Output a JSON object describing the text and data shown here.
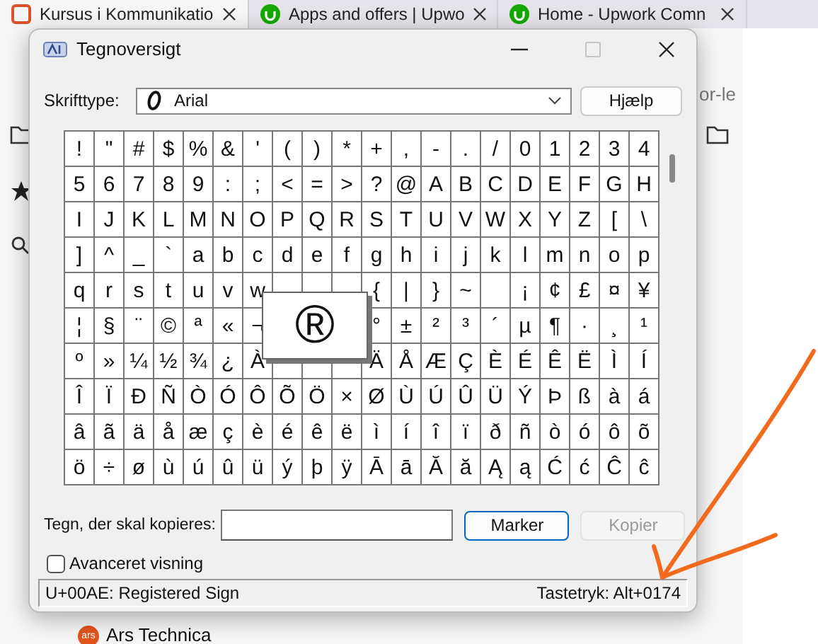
{
  "browser": {
    "tabs": [
      {
        "title": "Kursus i Kommunikatio",
        "selected": true
      },
      {
        "title": "Apps and offers | Upwo",
        "selected": false
      },
      {
        "title": "Home - Upwork Comn",
        "selected": false
      }
    ],
    "address_fragment": "or-le",
    "bookmark_badge": "ars",
    "bookmark": "Ars Technica"
  },
  "window": {
    "title": "Tegnoversigt"
  },
  "font": {
    "label": "Skrifttype:",
    "value": "Arial"
  },
  "help_button": "Hjælp",
  "grid": {
    "rows": [
      [
        "!",
        "\"",
        "#",
        "$",
        "%",
        "&",
        "'",
        "(",
        ")",
        "*",
        "+",
        ",",
        "-",
        ".",
        "/",
        "0",
        "1",
        "2",
        "3",
        "4"
      ],
      [
        "5",
        "6",
        "7",
        "8",
        "9",
        ":",
        ";",
        "<",
        "=",
        ">",
        "?",
        "@",
        "A",
        "B",
        "C",
        "D",
        "E",
        "F",
        "G",
        "H"
      ],
      [
        "I",
        "J",
        "K",
        "L",
        "M",
        "N",
        "O",
        "P",
        "Q",
        "R",
        "S",
        "T",
        "U",
        "V",
        "W",
        "X",
        "Y",
        "Z",
        "[",
        "\\"
      ],
      [
        "]",
        "^",
        "_",
        "`",
        "a",
        "b",
        "c",
        "d",
        "e",
        "f",
        "g",
        "h",
        "i",
        "j",
        "k",
        "l",
        "m",
        "n",
        "o",
        "p"
      ],
      [
        "q",
        "r",
        "s",
        "t",
        "u",
        "v",
        "w",
        null,
        null,
        null,
        "{",
        "|",
        "}",
        "~",
        null,
        "¡",
        "¢",
        "£",
        "¤",
        "¥"
      ],
      [
        "¦",
        "§",
        "¨",
        "©",
        "ª",
        "«",
        "¬",
        null,
        null,
        null,
        "°",
        "±",
        "²",
        "³",
        "´",
        "µ",
        "¶",
        "·",
        "¸",
        "¹"
      ],
      [
        "º",
        "»",
        "¼",
        "½",
        "¾",
        "¿",
        "À",
        null,
        null,
        null,
        "Ä",
        "Å",
        "Æ",
        "Ç",
        "È",
        "É",
        "Ê",
        "Ë",
        "Ì",
        "Í"
      ],
      [
        "Î",
        "Ï",
        "Ð",
        "Ñ",
        "Ò",
        "Ó",
        "Ô",
        "Õ",
        "Ö",
        "×",
        "Ø",
        "Ù",
        "Ú",
        "Û",
        "Ü",
        "Ý",
        "Þ",
        "ß",
        "à",
        "á"
      ],
      [
        "â",
        "ã",
        "ä",
        "å",
        "æ",
        "ç",
        "è",
        "é",
        "ê",
        "ë",
        "ì",
        "í",
        "î",
        "ï",
        "ð",
        "ñ",
        "ò",
        "ó",
        "ô",
        "õ"
      ],
      [
        "ö",
        "÷",
        "ø",
        "ù",
        "ú",
        "û",
        "ü",
        "ý",
        "þ",
        "ÿ",
        "Ā",
        "ā",
        "Ă",
        "ă",
        "Ą",
        "ą",
        "Ć",
        "ć",
        "Ĉ",
        "ĉ"
      ]
    ],
    "magnified": "®"
  },
  "copy": {
    "label": "Tegn, der skal kopieres:",
    "select_button": {
      "label": "Marker",
      "disabled": false
    },
    "copy_button": {
      "label": "Kopier",
      "disabled": true
    }
  },
  "advanced": {
    "label": "Avanceret visning",
    "checked": false
  },
  "status": {
    "character": "U+00AE: Registered Sign",
    "keystroke": "Tastetryk: Alt+0174"
  }
}
